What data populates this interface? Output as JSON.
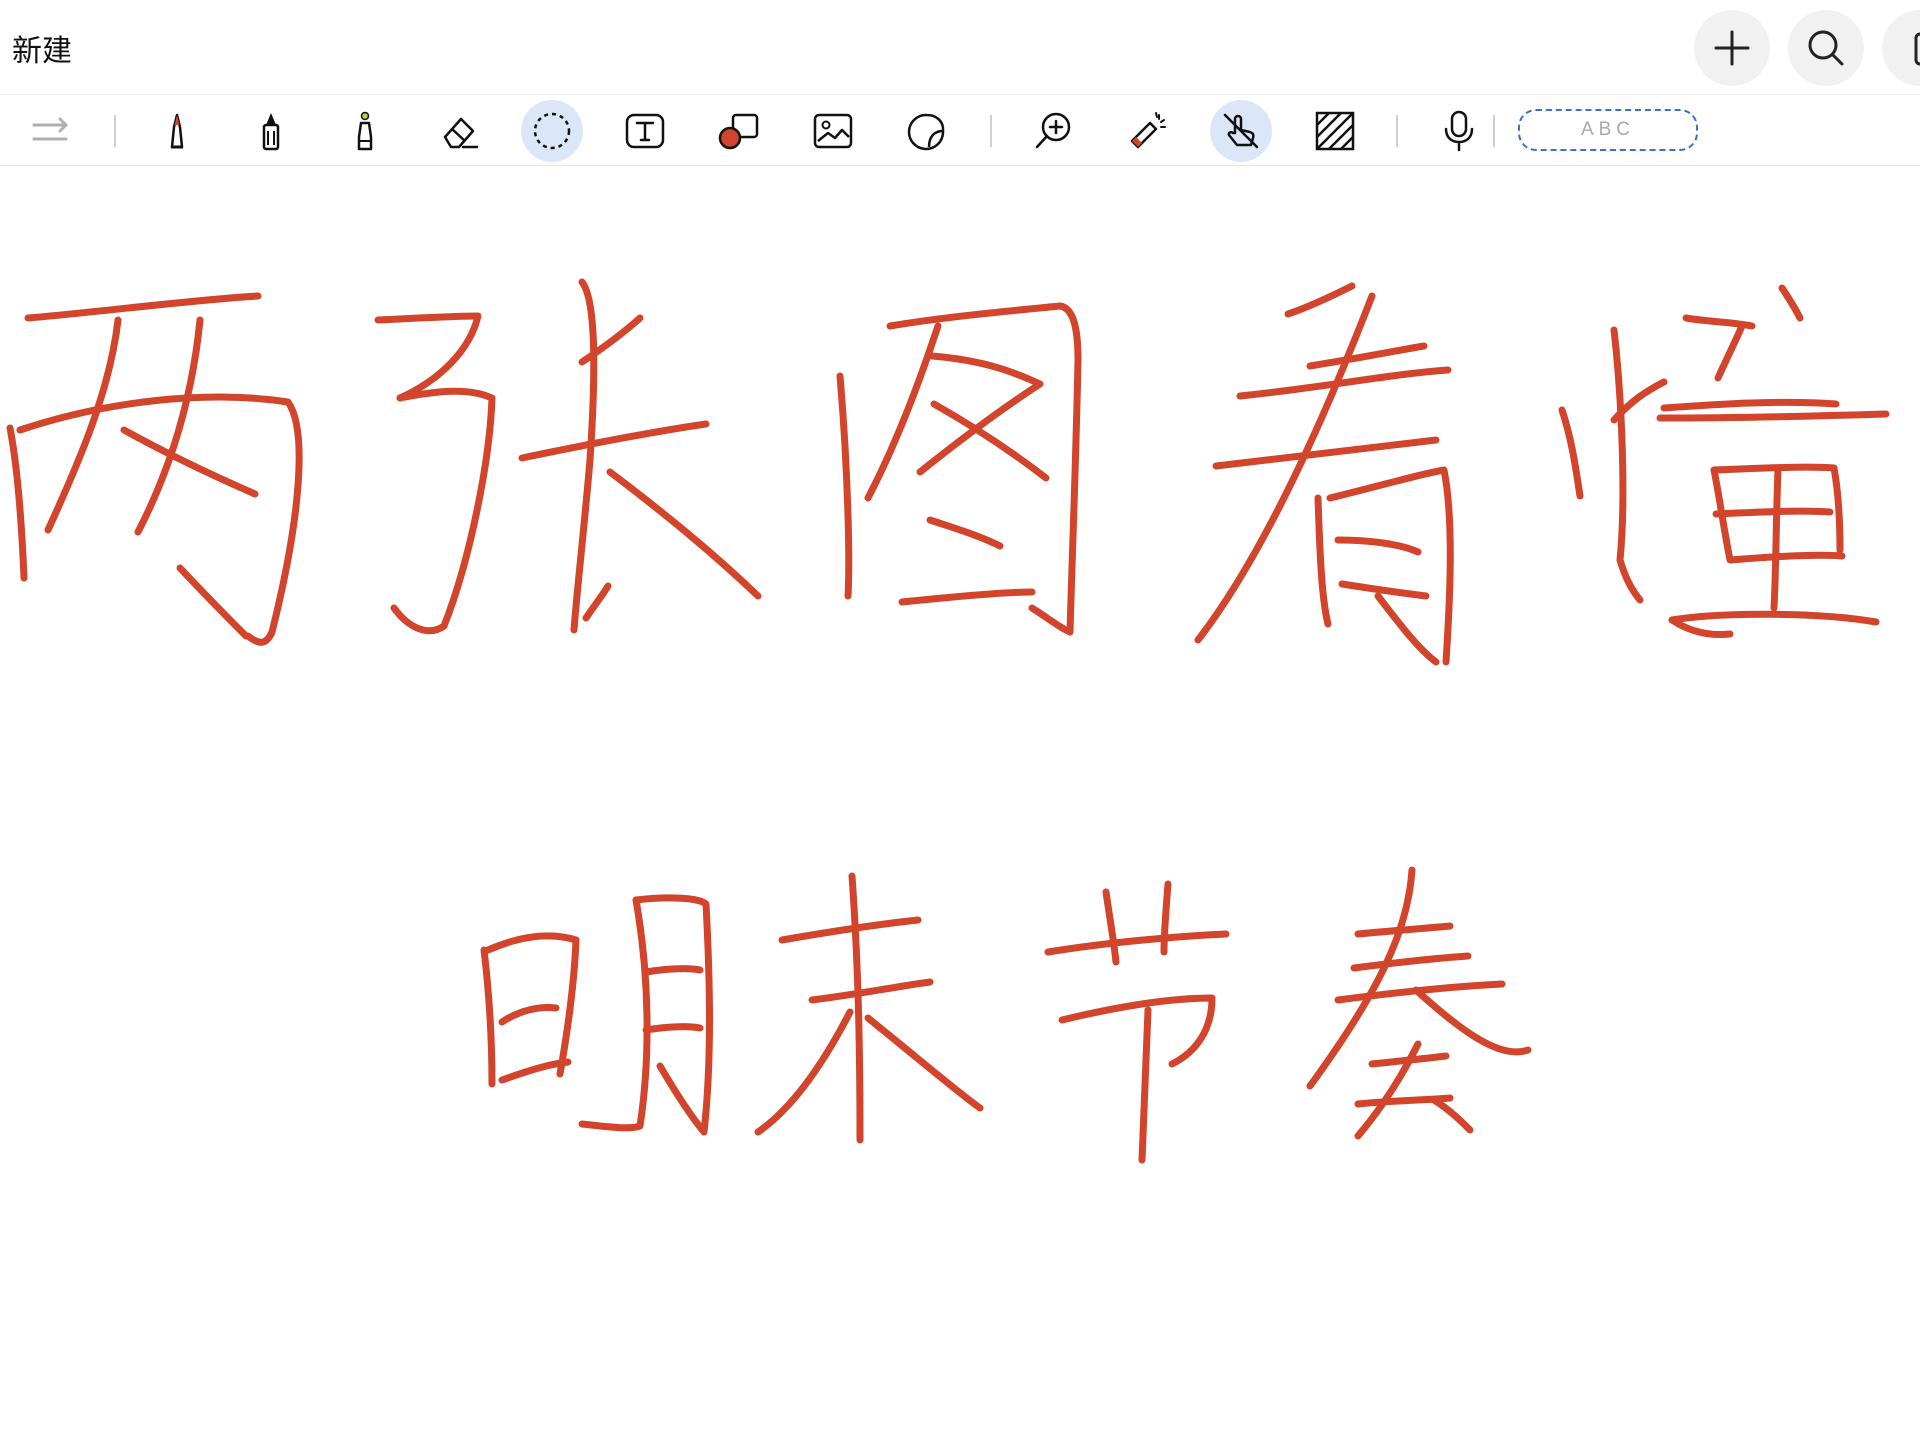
{
  "title_bar": {
    "title": "新建",
    "buttons": [
      {
        "name": "add-button",
        "icon": "plus-icon"
      },
      {
        "name": "search-button",
        "icon": "search-icon"
      },
      {
        "name": "page-button",
        "icon": "square-icon"
      }
    ]
  },
  "toolbar": {
    "tools": [
      {
        "name": "redo",
        "icon": "redo-icon",
        "active": false
      },
      {
        "name": "pen",
        "icon": "pen-icon",
        "active": false
      },
      {
        "name": "marker",
        "icon": "marker-icon",
        "active": false
      },
      {
        "name": "highlighter",
        "icon": "highlighter-icon",
        "active": false
      },
      {
        "name": "eraser",
        "icon": "eraser-icon",
        "active": false
      },
      {
        "name": "lasso",
        "icon": "lasso-icon",
        "active": true
      },
      {
        "name": "text",
        "icon": "text-box-icon",
        "active": false
      },
      {
        "name": "shape",
        "icon": "shape-icon",
        "active": false
      },
      {
        "name": "image",
        "icon": "image-icon",
        "active": false
      },
      {
        "name": "sticker",
        "icon": "sticker-icon",
        "active": false
      },
      {
        "name": "zoom",
        "icon": "zoom-in-icon",
        "active": false
      },
      {
        "name": "laser-pointer",
        "icon": "laser-pointer-icon",
        "active": false
      },
      {
        "name": "hand-touch",
        "icon": "hand-off-icon",
        "active": true
      },
      {
        "name": "paper-pattern",
        "icon": "hatch-pattern-icon",
        "active": false
      },
      {
        "name": "microphone",
        "icon": "microphone-icon",
        "active": false
      }
    ],
    "handwriting_placeholder": "ABC"
  },
  "canvas": {
    "ink_color": "#d2452c",
    "handwritten_lines": [
      "两张图看懂",
      "明末节奏"
    ]
  },
  "colors": {
    "accent": "#3b6fd6",
    "active_tool_bg": "#dbe6f8",
    "ink": "#d2452c"
  }
}
